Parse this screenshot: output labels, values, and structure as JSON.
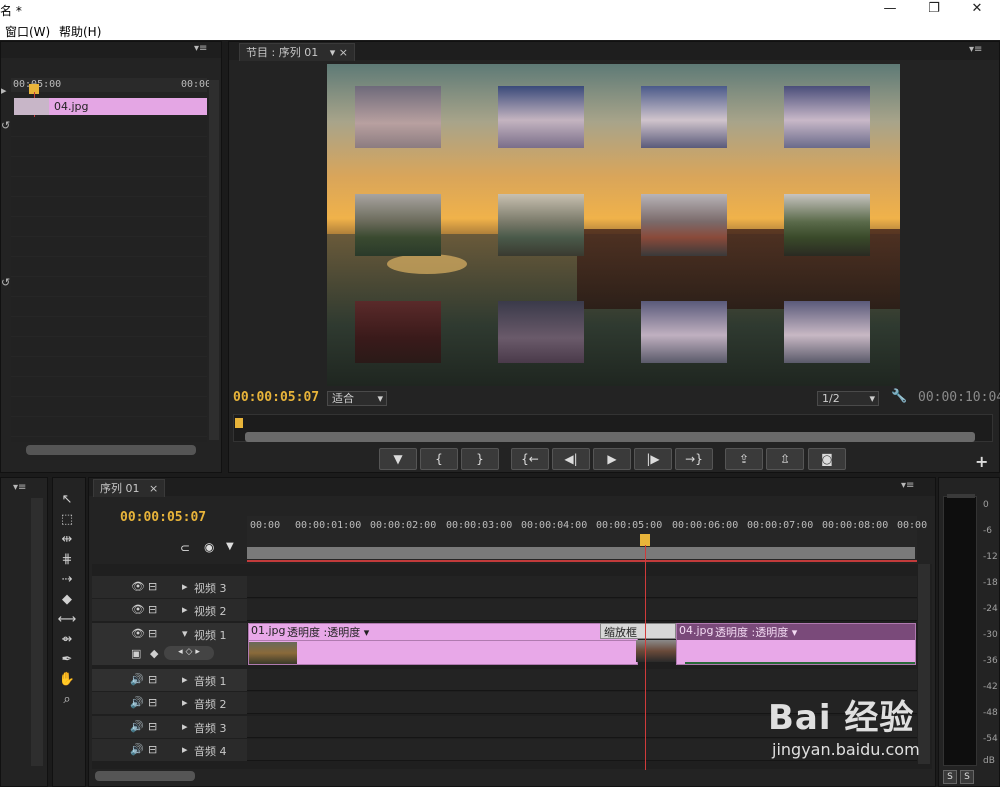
{
  "window": {
    "title": "名 *",
    "minimize": "—",
    "restore": "❐",
    "close": "✕"
  },
  "menu": {
    "items": [
      "窗口(W)",
      "帮助(H)"
    ]
  },
  "source_panel": {
    "ruler_start": "00:05:00",
    "ruler_end": "00:00",
    "clip_label": "04.jpg"
  },
  "program_monitor": {
    "tab_label": "节目 : 序列 01",
    "current_time": "00:00:05:07",
    "fit_label": "适合",
    "resolution": "1/2",
    "duration": "00:00:10:04"
  },
  "transport": {
    "buttons": [
      {
        "name": "add-marker-button",
        "glyph": "▼"
      },
      {
        "name": "mark-in-button",
        "glyph": "{"
      },
      {
        "name": "mark-out-button",
        "glyph": "}"
      },
      {
        "name": "go-to-in-button",
        "glyph": "{←"
      },
      {
        "name": "step-back-button",
        "glyph": "◀|"
      },
      {
        "name": "play-button",
        "glyph": "▶"
      },
      {
        "name": "step-forward-button",
        "glyph": "|▶"
      },
      {
        "name": "go-to-out-button",
        "glyph": "→}"
      },
      {
        "name": "lift-button",
        "glyph": "⇪"
      },
      {
        "name": "extract-button",
        "glyph": "⇫"
      },
      {
        "name": "export-frame-button",
        "glyph": "◙"
      }
    ],
    "add_button": "+"
  },
  "timeline": {
    "tab_label": "序列 01",
    "current_time": "00:00:05:07",
    "ruler_labels": [
      "00:00",
      "00:00:01:00",
      "00:00:02:00",
      "00:00:03:00",
      "00:00:04:00",
      "00:00:05:00",
      "00:00:06:00",
      "00:00:07:00",
      "00:00:08:00",
      "00:00"
    ],
    "tracks": {
      "v3": "视频 3",
      "v2": "视频 2",
      "v1": "视频 1",
      "a1": "音频 1",
      "a2": "音频 2",
      "a3": "音频 3",
      "a4": "音频 4"
    },
    "clip1_label": "01.jpg",
    "clip1_effect": "透明度 :透明度 ▾",
    "transition_label": "缩放框",
    "clip2_label": "04.jpg",
    "clip2_effect": "透明度 :透明度 ▾"
  },
  "audio_meter": {
    "labels": [
      "0",
      "-6",
      "-12",
      "-18",
      "-24",
      "-30",
      "-36",
      "-42",
      "-48",
      "-54",
      "dB"
    ],
    "solo_left": "S",
    "solo_right": "S"
  },
  "watermark": {
    "brand": "Bai 经验",
    "url": "jingyan.baidu.com"
  }
}
